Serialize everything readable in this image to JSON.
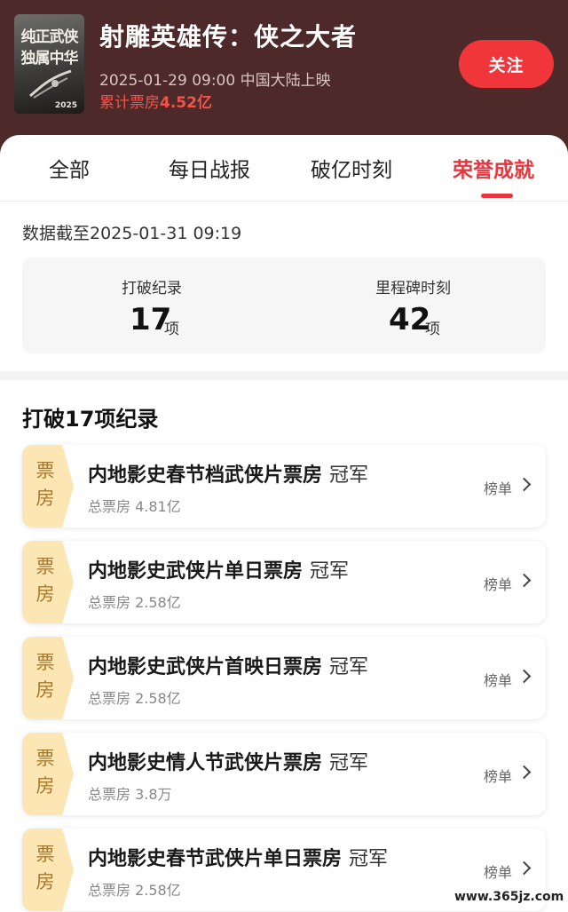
{
  "header": {
    "poster_text_line1": "纯正武侠",
    "poster_text_line2": "独属中华",
    "poster_year": "2025",
    "title": "射雕英雄传：侠之大者",
    "release": "2025-01-29 09:00 中国大陆上映",
    "boxoffice_label": "累计票房",
    "boxoffice_value": "4.52亿",
    "follow_label": "关注"
  },
  "tabs": [
    {
      "label": "全部",
      "active": false
    },
    {
      "label": "每日战报",
      "active": false
    },
    {
      "label": "破亿时刻",
      "active": false
    },
    {
      "label": "荣誉成就",
      "active": true
    }
  ],
  "data_time": "数据截至2025-01-31  09:19",
  "stats": [
    {
      "label": "打破纪录",
      "value": "17",
      "unit": "项"
    },
    {
      "label": "里程碑时刻",
      "value": "42",
      "unit": "项"
    }
  ],
  "section_title": "打破17项纪录",
  "records": [
    {
      "tag": "票房",
      "name": "内地影史春节档武侠片票房",
      "rank": "冠军",
      "sub": "总票房 4.81亿",
      "link": "榜单"
    },
    {
      "tag": "票房",
      "name": "内地影史武侠片单日票房",
      "rank": "冠军",
      "sub": "总票房 2.58亿",
      "link": "榜单"
    },
    {
      "tag": "票房",
      "name": "内地影史武侠片首映日票房",
      "rank": "冠军",
      "sub": "总票房 2.58亿",
      "link": "榜单"
    },
    {
      "tag": "票房",
      "name": "内地影史情人节武侠片票房",
      "rank": "冠军",
      "sub": "总票房 3.8万",
      "link": "榜单"
    },
    {
      "tag": "票房",
      "name": "内地影史春节武侠片单日票房",
      "rank": "冠军",
      "sub": "总票房 2.58亿",
      "link": "榜单"
    }
  ],
  "watermark": "www.365jz.com",
  "colors": {
    "header_bg": "#4d2a29",
    "accent": "#e8363e",
    "boxoffice": "#f2544c",
    "tag_bg": "#fbe6b4",
    "tag_text": "#a6782c"
  }
}
